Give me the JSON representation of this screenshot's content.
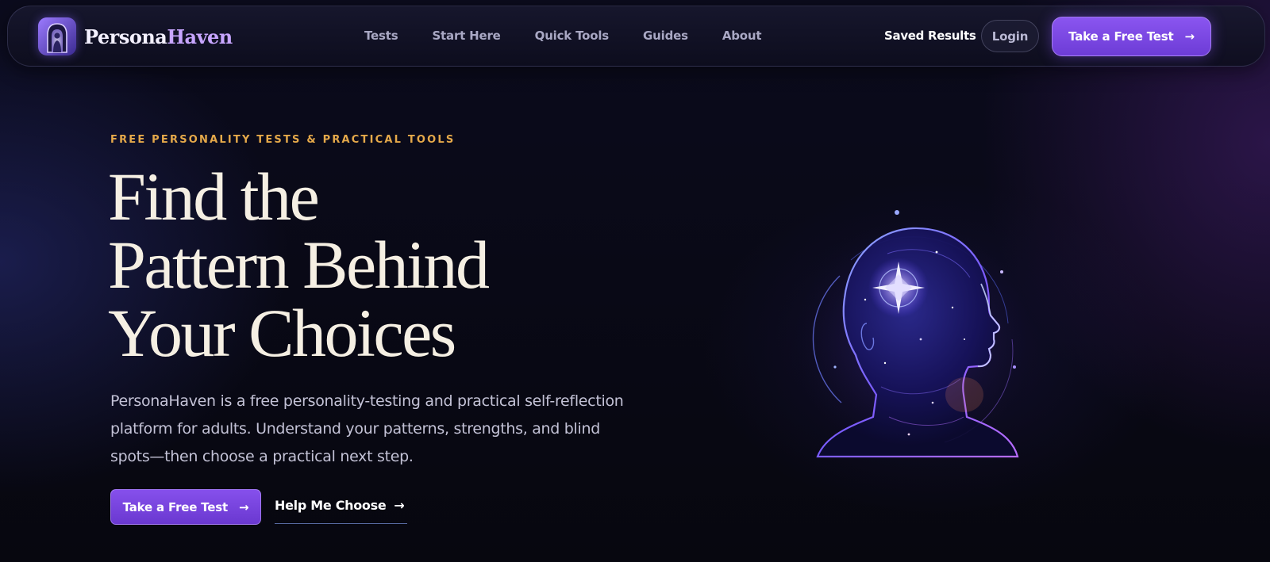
{
  "brand": {
    "name_part1": "Persona",
    "name_part2": "Haven",
    "logo_icon": "persona-haven-logo-icon",
    "accent_color": "#c8a6ff"
  },
  "nav": {
    "links": [
      {
        "label": "Tests"
      },
      {
        "label": "Start Here"
      },
      {
        "label": "Quick Tools"
      },
      {
        "label": "Guides"
      },
      {
        "label": "About"
      }
    ],
    "saved_results": "Saved Results",
    "login": "Login",
    "cta_label": "Take a Free Test",
    "cta_arrow": "→"
  },
  "hero": {
    "eyebrow": "FREE PERSONALITY TESTS & PRACTICAL TOOLS",
    "title_lines": [
      "Find the",
      "Pattern Behind",
      "Your Choices"
    ],
    "description": "PersonaHaven is a free personality-testing and practical self-reflection platform for adults. Understand your patterns, strengths, and blind spots—then choose a practical next step.",
    "primary_cta": "Take a Free Test",
    "primary_arrow": "→",
    "secondary_cta": "Help Me Choose",
    "secondary_arrow": "→",
    "illustration_icon": "glowing-head-compass-icon"
  },
  "colors": {
    "primary": "#7c47e6",
    "eyebrow": "#e5a94a",
    "background": "#080814",
    "heading": "#f5efe3"
  }
}
